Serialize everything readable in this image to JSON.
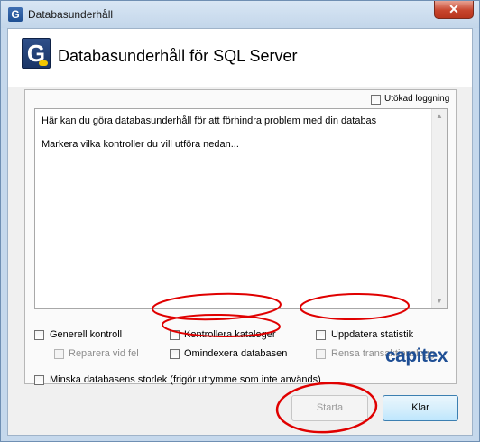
{
  "window": {
    "title": "Databasunderhåll",
    "close_glyph": "✕"
  },
  "header": {
    "title": "Databasunderhåll för SQL Server",
    "logo_glyph": "G"
  },
  "options": {
    "extended_logging": "Utökad loggning",
    "description_lines": [
      "Här kan du göra databasunderhåll för att förhindra problem med din databas",
      "Markera vilka kontroller du vill utföra nedan..."
    ],
    "checks": {
      "general": "Generell kontroll",
      "repair": "Reparera vid fel",
      "catalogs": "Kontrollera kataloger",
      "reindex": "Omindexera databasen",
      "stats": "Uppdatera statistik",
      "trunclog": "Rensa transaktionslogg",
      "shrink": "Minska databasens storlek (frigör utrymme som inte används)"
    }
  },
  "brand": "capitex",
  "buttons": {
    "start": "Starta",
    "close": "Klar"
  },
  "annotation_color": "#e00000"
}
